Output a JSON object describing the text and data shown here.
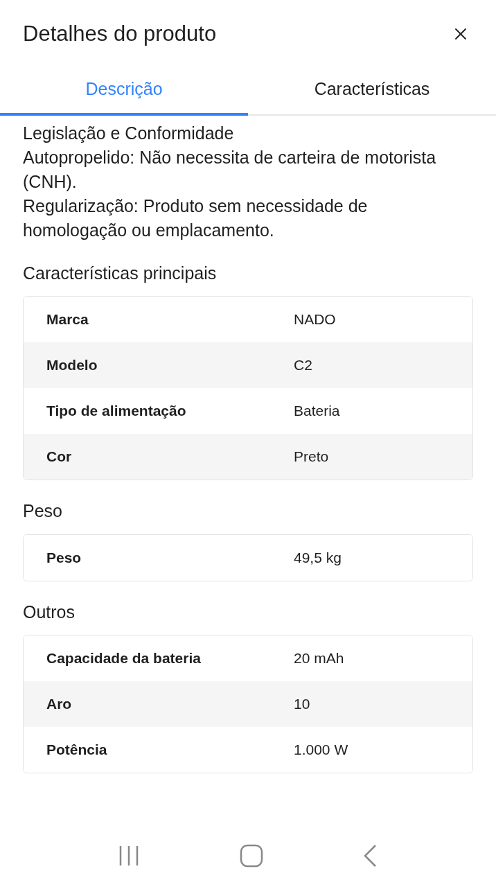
{
  "header": {
    "title": "Detalhes do produto"
  },
  "tabs": [
    {
      "label": "Descrição",
      "selected": true
    },
    {
      "label": "Características",
      "selected": false
    }
  ],
  "description": [
    "Legislação e Conformidade",
    "Autopropelido: Não necessita de carteira de motorista (CNH).",
    "Regularização: Produto sem necessidade de homologação ou emplacamento."
  ],
  "sections": [
    {
      "title": "Características principais",
      "rows": [
        [
          "Marca",
          "NADO"
        ],
        [
          "Modelo",
          "C2"
        ],
        [
          "Tipo de alimentação",
          "Bateria"
        ],
        [
          "Cor",
          "Preto"
        ]
      ]
    },
    {
      "title": "Peso",
      "rows": [
        [
          "Peso",
          "49,5 kg"
        ]
      ]
    },
    {
      "title": "Outros",
      "rows": [
        [
          "Capacidade da bateria",
          "20 mAh"
        ],
        [
          "Aro",
          "10"
        ],
        [
          "Potência",
          "1.000 W"
        ]
      ]
    }
  ]
}
